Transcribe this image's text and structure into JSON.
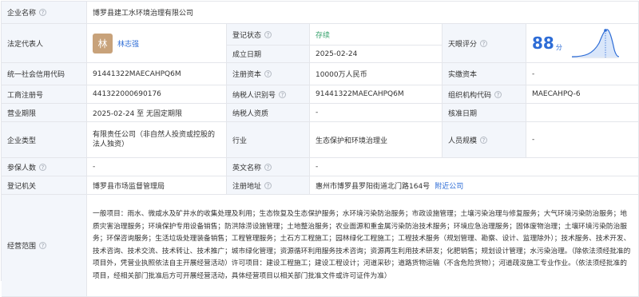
{
  "company_name": {
    "label": "企业名称",
    "value": "博罗县建工水环境治理有限公司"
  },
  "legal_rep": {
    "label": "法定代表人",
    "avatar": "林",
    "name": "林志强"
  },
  "reg_status": {
    "label": "登记状态",
    "value": "存续"
  },
  "established": {
    "label": "成立日期",
    "value": "2025-02-24"
  },
  "tianyan": {
    "label": "天眼评分",
    "score": "88",
    "unit": "分"
  },
  "credit_code": {
    "label": "统一社会信用代码",
    "value": "91441322MAECAHPQ6M"
  },
  "reg_capital": {
    "label": "注册资本",
    "value": "10000万人民币"
  },
  "paid_capital": {
    "label": "实缴资本",
    "value": "-"
  },
  "biz_reg_no": {
    "label": "工商注册号",
    "value": "441322000690176"
  },
  "taxpayer_id": {
    "label": "纳税人识别号",
    "value": "91441322MAECAHPQ6M"
  },
  "org_code": {
    "label": "组织机构代码",
    "value": "MAECAHPQ-6"
  },
  "biz_term": {
    "label": "营业期限",
    "value": "2025-02-24 至 无固定期限"
  },
  "taxpayer_qual": {
    "label": "纳税人资质",
    "value": "-"
  },
  "approval_date": {
    "label": "核准日期"
  },
  "company_type": {
    "label": "企业类型",
    "value": "有限责任公司（非自然人投资或控股的法人独资）"
  },
  "industry": {
    "label": "行业",
    "value": "生态保护和环境治理业"
  },
  "staff_size": {
    "label": "人员规模",
    "value": "-"
  },
  "insured": {
    "label": "参保人数",
    "value": "-"
  },
  "english_name": {
    "label": "英文名称",
    "value": "-"
  },
  "reg_authority": {
    "label": "登记机关",
    "value": "博罗县市场监督管理局"
  },
  "reg_address": {
    "label": "注册地址",
    "value": "惠州市博罗县罗阳街道北门路164号",
    "link": "附近公司"
  },
  "biz_scope": {
    "label": "经营范围",
    "value": "一般项目：雨水、微咸水及矿井水的收集处理及利用；生态恢复及生态保护服务；水环境污染防治服务；市政设施管理；土壤污染治理与修复服务；大气环境污染防治服务；地质灾害治理服务；环境保护专用设备销售；防洪除涝设施管理；土地整治服务；农业面源和重金属污染防治技术服务；环境应急治理服务；固体废物治理；土壤环境污染防治服务；环保咨询服务；生活垃圾处理装备销售；工程管理服务；土石方工程施工；园林绿化工程施工；工程技术服务（规划管理、勘察、设计、监理除外）；技术服务、技术开发、技术咨询、技术交流、技术转让、技术推广；城市绿化管理；资源循环利用服务技术咨询；资源再生利用技术研发；化肥销售；规划设计管理；水污染治理。（除依法须经批准的项目外，凭营业执照依法自主开展经营活动）许可项目：建设工程施工；建设工程设计；河道采砂；道路货物运输（不含危险货物）；河道疏浚施工专业作业。（依法须经批准的项目，经相关部门批准后方可开展经营活动，具体经营项目以相关部门批准文件或许可证件为准）"
  },
  "colors": {
    "label_bg": "#f3f6fb",
    "border": "#e4e6eb",
    "accent": "#2d6cd6",
    "status_green": "#39a36e"
  },
  "icons": [
    "help-circle-icon",
    "lock-icon",
    "score-curve-icon"
  ]
}
